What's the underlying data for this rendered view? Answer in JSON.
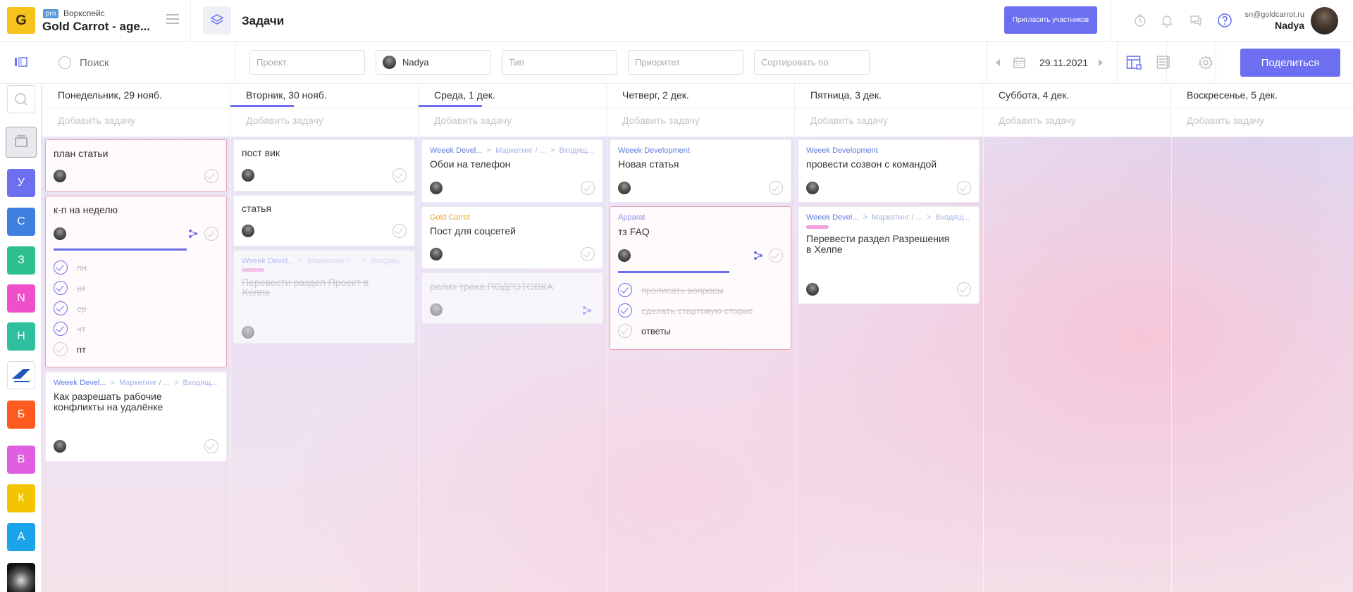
{
  "workspace": {
    "pro": "pro",
    "label": "Воркспейс",
    "name": "Gold Carrot - age..."
  },
  "header": {
    "title": "Задачи",
    "invite": "Пригласить участников",
    "email": "sn@goldcarrot.ru",
    "user": "Nadya"
  },
  "filters": {
    "search": "Поиск",
    "project": "Проект",
    "user": "Nadya",
    "type": "Тип",
    "priority": "Приоритет",
    "sort": "Сортировать по",
    "date": "29.11.2021",
    "share": "Поделиться"
  },
  "sidebar": [
    "У",
    "С",
    "З",
    "N",
    "Н",
    "Б",
    "В",
    "К",
    "А"
  ],
  "colors": {
    "accent": "#6b6ff0",
    "logo": "#f5c31c",
    "sidebar": [
      "#6b6ff0",
      "#3f7fe0",
      "#2ebf8e",
      "#ef4fc8",
      "#2ebf9f",
      "#ff5a1f",
      "#df5fe0",
      "#f2c500",
      "#1aa3e8"
    ]
  },
  "add_task": "Добавить задачу",
  "days": [
    {
      "name": "Понедельник, 29 нояб."
    },
    {
      "name": "Вторник, 30 нояб."
    },
    {
      "name": "Среда, 1 дек."
    },
    {
      "name": "Четверг, 2 дек."
    },
    {
      "name": "Пятница, 3 дек."
    },
    {
      "name": "Суббота, 4 дек."
    },
    {
      "name": "Воскресенье, 5 дек."
    }
  ],
  "cards": {
    "mon": [
      {
        "title": "план статьи"
      },
      {
        "title": "к-п на неделю",
        "progress": 0.8,
        "subtasks": [
          {
            "t": "пн"
          },
          {
            "t": "вт"
          },
          {
            "t": "ср"
          },
          {
            "t": "чт"
          },
          {
            "t": "пт"
          }
        ]
      },
      {
        "project": "Weeek Devel...",
        "path1": "Маркетинг / ...",
        "path2": "Входящ...",
        "title1": "Как разрешать рабочие",
        "title2": "конфликты на удалёнке"
      }
    ],
    "tue": [
      {
        "title": "пост вик"
      },
      {
        "title": "статья"
      },
      {
        "project": "Weeek Devel...",
        "path1": "Маркетинг / ...",
        "path2": "Входящ...",
        "title1": "Перевести раздел Проект в",
        "title2": "Хелпе"
      }
    ],
    "wed": [
      {
        "project": "Weeek Devel...",
        "path1": "Маркетинг / ...",
        "path2": "Входящ...",
        "title": "Обои на телефон"
      },
      {
        "project": "Gold Carrot",
        "title": "Пост для соцсетей"
      },
      {
        "title": "релиз трека ПОДГОТОВКА"
      }
    ],
    "thu": [
      {
        "project": "Weeek Development",
        "title": "Новая статья"
      },
      {
        "project": "Apparat",
        "title": "тз FAQ",
        "progress": 0.67,
        "subtasks": [
          {
            "t": "прописать вопросы"
          },
          {
            "t": "сделать стартовую сторис"
          },
          {
            "t": "ответы"
          }
        ]
      }
    ],
    "fri": [
      {
        "project": "Weeek Development",
        "title": "провести созвон с командой"
      },
      {
        "project": "Weeek Devel...",
        "path1": "Маркетинг / ...",
        "path2": "Входящ...",
        "title1": "Перевести раздел Разрешения",
        "title2": "в Хелпе"
      }
    ]
  }
}
